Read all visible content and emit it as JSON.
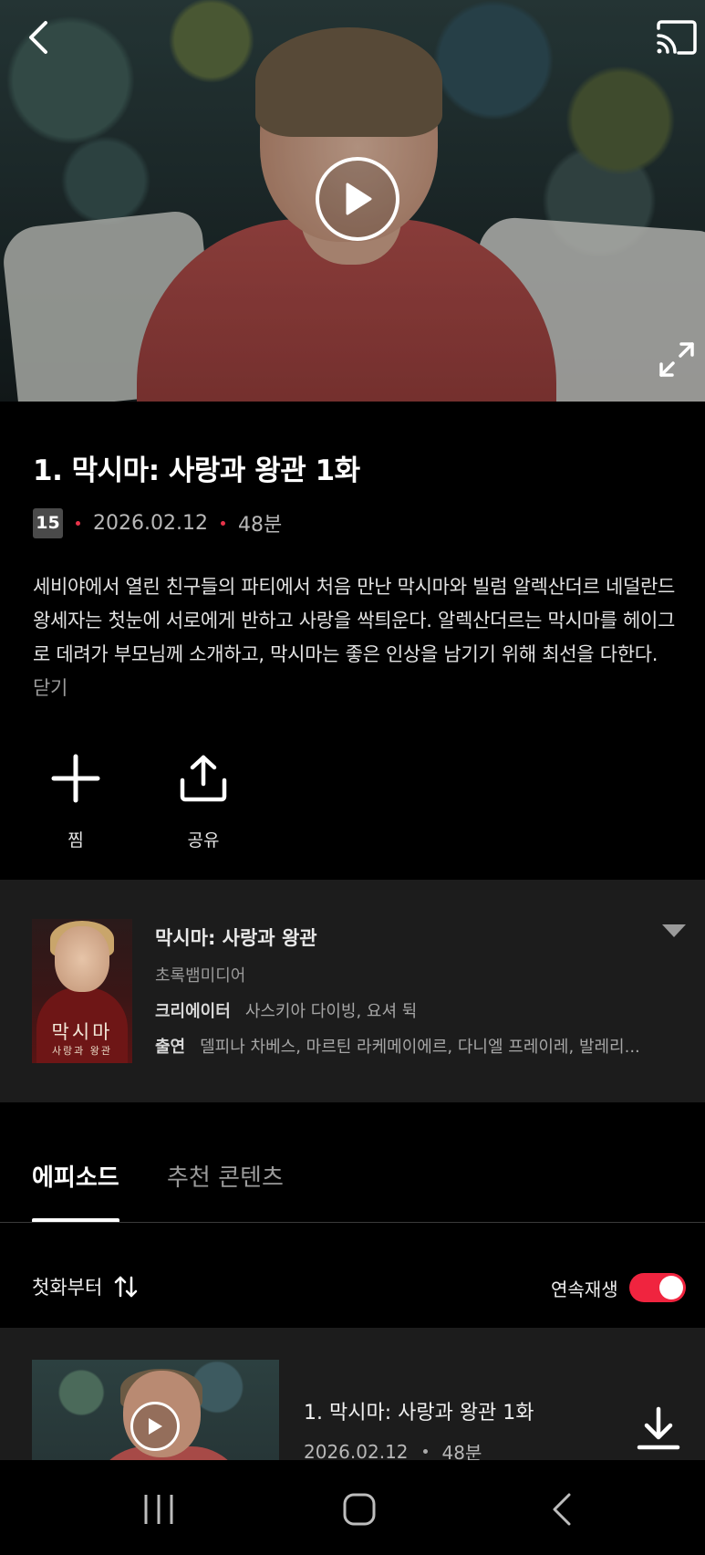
{
  "hero": {
    "back_icon": "chevron-left-icon",
    "cast_icon": "cast-icon",
    "play_icon": "play-circle-icon",
    "fullscreen_icon": "expand-icon"
  },
  "episode": {
    "title": "1. 막시마: 사랑과 왕관 1화",
    "age_rating": "15",
    "date": "2026.02.12",
    "duration": "48분",
    "description": "세비야에서 열린 친구들의 파티에서 처음 만난 막시마와 빌럼 알렉산더르 네덜란드 왕세자는 첫눈에 서로에게 반하고 사랑을 싹틔운다. 알렉산더르는 막시마를 헤이그로 데려가 부모님께 소개하고, 막시마는 좋은 인상을 남기기 위해 최선을 다한다.",
    "description_close": "닫기"
  },
  "actions": {
    "want_label": "찜",
    "share_label": "공유"
  },
  "series": {
    "poster_title": "막시마",
    "poster_subtitle": "사랑과 왕관",
    "title": "막시마: 사랑과 왕관",
    "studio": "초록뱀미디어",
    "creator_key": "크리에이터",
    "creator_value": "사스키아 다이빙, 요셔 뒥",
    "cast_key": "출연",
    "cast_value": "델피나 차베스, 마르틴 라케메이에르, 다니엘 프레이레, 발레리..."
  },
  "tabs": {
    "episodes": "에피소드",
    "recommended": "추천 콘텐츠"
  },
  "list_controls": {
    "sort_label": "첫화부터",
    "autoplay_label": "연속재생",
    "autoplay_on": true
  },
  "episode_list": [
    {
      "title": "1. 막시마: 사랑과 왕관 1화",
      "date": "2026.02.12",
      "duration": "48분"
    }
  ],
  "colors": {
    "accent": "#f0243f",
    "background": "#000000",
    "card": "#1c1c1c"
  }
}
